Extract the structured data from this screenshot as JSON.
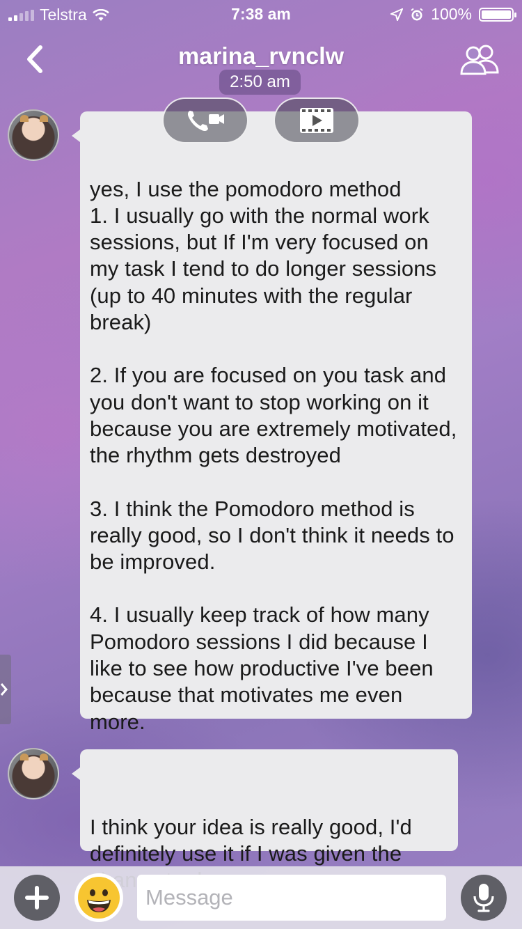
{
  "status_bar": {
    "carrier": "Telstra",
    "time": "7:38 am",
    "battery": "100%",
    "battery_level": 1.0
  },
  "header": {
    "title": "marina_rvnclw",
    "subtitle_time": "2:50 am",
    "back_icon": "chevron-left-icon",
    "members_icon": "members-icon"
  },
  "call_actions": {
    "voice_video_icon": "phone-video-icon",
    "screening_icon": "video-play-icon"
  },
  "messages": [
    {
      "paragraphs": [
        "yes, I use the pomodoro method\n1. I usually go with the normal work sessions, but If I'm very focused on my task I tend to do longer sessions (up to 40 minutes with the regular break)",
        "2. If you are focused on you task and you don't want to stop working on it because you are extremely motivated, the rhythm gets destroyed",
        "3. I think the Pomodoro method is really good, so I don't think it needs to be improved.",
        "4. I usually keep track of how many Pomodoro sessions I did because I like to see how productive I've been because that motivates me even more."
      ]
    },
    {
      "paragraphs": [
        "I think your idea is really good, I'd definitely use it if I was given the chance to do so"
      ]
    }
  ],
  "composer": {
    "placeholder": "Message",
    "add_icon": "plus-icon",
    "sticker_icon": "smiley-icon",
    "mic_icon": "microphone-icon"
  }
}
